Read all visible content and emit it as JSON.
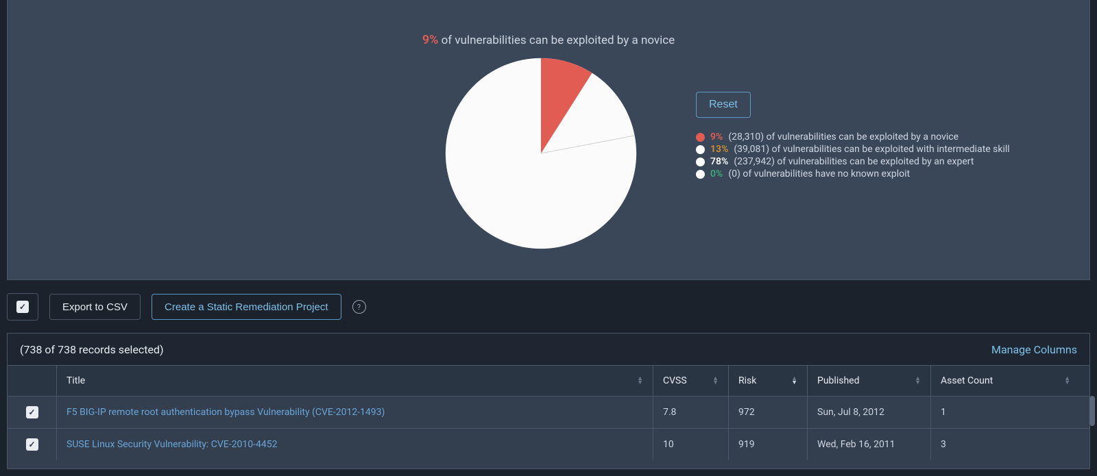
{
  "chart_data": {
    "type": "pie",
    "title_pct": "9%",
    "title_rest": " of vulnerabilities can be exploited by a novice",
    "slices": [
      {
        "label": "novice",
        "pct": 9,
        "count": "28,310",
        "color": "#e15c53",
        "desc": " of vulnerabilities can be exploited by a novice"
      },
      {
        "label": "intermediate",
        "pct": 13,
        "count": "39,081",
        "color": "#d29032",
        "desc": " of vulnerabilities can be exploited with intermediate skill"
      },
      {
        "label": "expert",
        "pct": 78,
        "count": "237,942",
        "color": "#ffffff",
        "desc": " of vulnerabilities can be exploited by an expert"
      },
      {
        "label": "none",
        "pct": 0,
        "count": "0",
        "color": "#3fa97a",
        "desc": " of vulnerabilities have no known exploit"
      }
    ]
  },
  "actions": {
    "reset": "Reset",
    "export_csv": "Export to CSV",
    "create_project": "Create a Static Remediation Project",
    "manage_columns": "Manage Columns"
  },
  "selection_text": "(738 of 738 records selected)",
  "columns": {
    "title": "Title",
    "cvss": "CVSS",
    "risk": "Risk",
    "published": "Published",
    "asset_count": "Asset Count"
  },
  "rows": [
    {
      "checked": true,
      "title": "F5 BIG-IP remote root authentication bypass Vulnerability (CVE-2012-1493)",
      "cvss": "7.8",
      "risk": "972",
      "published": "Sun, Jul 8, 2012",
      "asset_count": "1"
    },
    {
      "checked": true,
      "title": "SUSE Linux Security Vulnerability: CVE-2010-4452",
      "cvss": "10",
      "risk": "919",
      "published": "Wed, Feb 16, 2011",
      "asset_count": "3"
    }
  ]
}
